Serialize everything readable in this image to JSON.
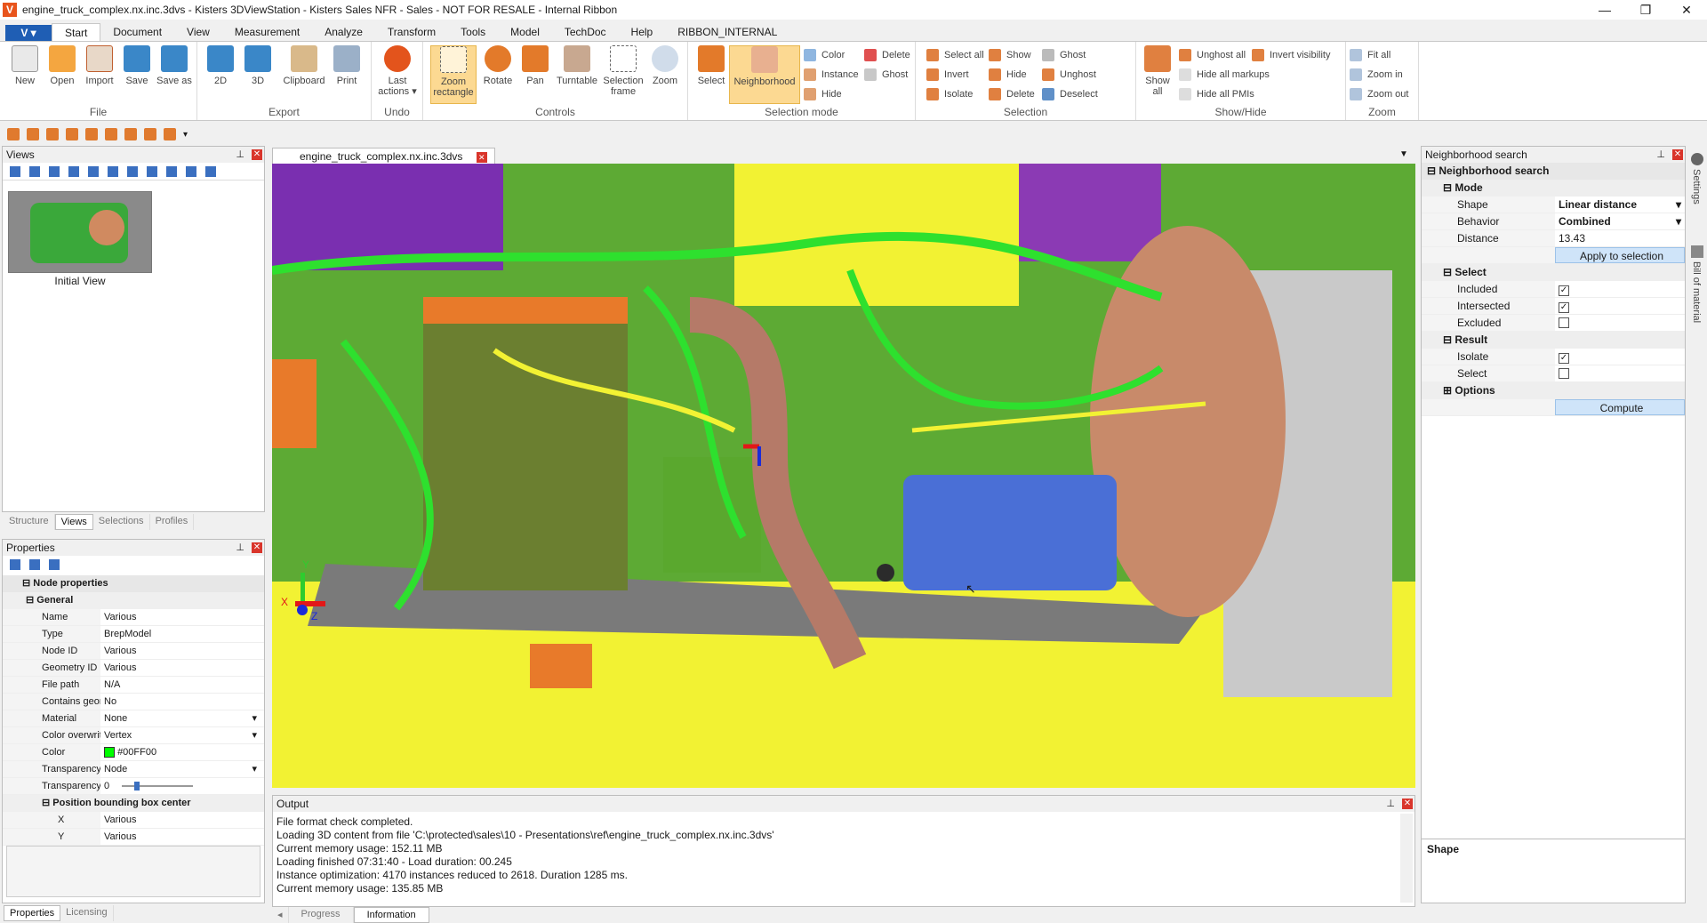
{
  "window": {
    "title": "engine_truck_complex.nx.inc.3dvs - Kisters 3DViewStation - Kisters Sales NFR - Sales - NOT FOR RESALE - Internal Ribbon",
    "app_icon": "V"
  },
  "ribbon": {
    "app_menu": "V",
    "tabs": [
      "Start",
      "Document",
      "View",
      "Measurement",
      "Analyze",
      "Transform",
      "Tools",
      "Model",
      "TechDoc",
      "Help",
      "RIBBON_INTERNAL"
    ],
    "groups": {
      "file": {
        "label": "File",
        "buttons": [
          "New",
          "Open",
          "Import",
          "Save",
          "Save as"
        ]
      },
      "export": {
        "label": "Export",
        "buttons": [
          "2D",
          "3D",
          "Clipboard",
          "Print"
        ]
      },
      "undo": {
        "label": "Undo",
        "buttons": [
          "Last actions"
        ]
      },
      "controls": {
        "label": "Controls",
        "buttons": [
          "Zoom rectangle",
          "Rotate",
          "Pan",
          "Turntable",
          "Selection frame",
          "Zoom"
        ]
      },
      "selection_mode": {
        "label": "Selection mode",
        "big": [
          "Select",
          "Neighborhood"
        ],
        "small": [
          "Color",
          "Instance",
          "Hide",
          "Delete",
          "Ghost"
        ]
      },
      "selection": {
        "label": "Selection",
        "small": [
          "Select all",
          "Invert",
          "Isolate",
          "Show",
          "Hide",
          "Delete",
          "Ghost",
          "Unghost",
          "Deselect"
        ]
      },
      "showhide": {
        "label": "Show/Hide",
        "big": [
          "Show all"
        ],
        "small": [
          "Unghost all",
          "Hide all markups",
          "Hide all PMIs",
          "Invert visibility"
        ]
      },
      "zoom": {
        "label": "Zoom",
        "small": [
          "Fit all",
          "Zoom in",
          "Zoom out"
        ]
      }
    }
  },
  "views_panel": {
    "title": "Views",
    "thumb_label": "Initial View",
    "tabs": [
      "Structure",
      "Views",
      "Selections",
      "Profiles"
    ]
  },
  "properties_panel": {
    "title": "Properties",
    "root": "Node properties",
    "general": "General",
    "rows": [
      {
        "name": "Name",
        "value": "Various"
      },
      {
        "name": "Type",
        "value": "BrepModel"
      },
      {
        "name": "Node ID",
        "value": "Various"
      },
      {
        "name": "Geometry ID",
        "value": "Various"
      },
      {
        "name": "File path",
        "value": "N/A"
      },
      {
        "name": "Contains geomet...",
        "value": "No"
      },
      {
        "name": "Material",
        "value": "None"
      },
      {
        "name": "Color overwrite",
        "value": "Vertex"
      },
      {
        "name": "Color",
        "value": "#00FF00"
      },
      {
        "name": "Transparency ove...",
        "value": "Node"
      },
      {
        "name": "Transparency",
        "value": "0"
      }
    ],
    "bbox_cat": "Position bounding box center",
    "bbox_rows": [
      {
        "name": "X",
        "value": "Various"
      },
      {
        "name": "Y",
        "value": "Various"
      }
    ],
    "tabs": [
      "Properties",
      "Licensing"
    ]
  },
  "document": {
    "tab": "engine_truck_complex.nx.inc.3dvs"
  },
  "output": {
    "title": "Output",
    "lines": [
      "File format check completed.",
      "Loading 3D content from file 'C:\\protected\\sales\\10 - Presentations\\ref\\engine_truck_complex.nx.inc.3dvs'",
      "Current memory usage: 152.11 MB",
      "Loading finished 07:31:40 - Load duration: 00.245",
      "Instance optimization: 4170 instances reduced to 2618. Duration 1285 ms.",
      "Current memory usage: 135.85 MB"
    ],
    "tabs": [
      "Progress",
      "Information"
    ]
  },
  "neighborhood": {
    "title": "Neighborhood search",
    "root": "Neighborhood search",
    "mode": "Mode",
    "shape_label": "Shape",
    "shape_value": "Linear distance",
    "behavior_label": "Behavior",
    "behavior_value": "Combined",
    "distance_label": "Distance",
    "distance_value": "13.43",
    "apply": "Apply to selection",
    "select": "Select",
    "included": "Included",
    "intersected": "Intersected",
    "excluded": "Excluded",
    "result": "Result",
    "isolate": "Isolate",
    "select_opt": "Select",
    "options": "Options",
    "compute": "Compute",
    "desc_title": "Shape",
    "side_tabs": [
      "Settings",
      "Bill of material"
    ]
  },
  "axis": {
    "x": "X",
    "y": "Y",
    "z": "Z"
  }
}
